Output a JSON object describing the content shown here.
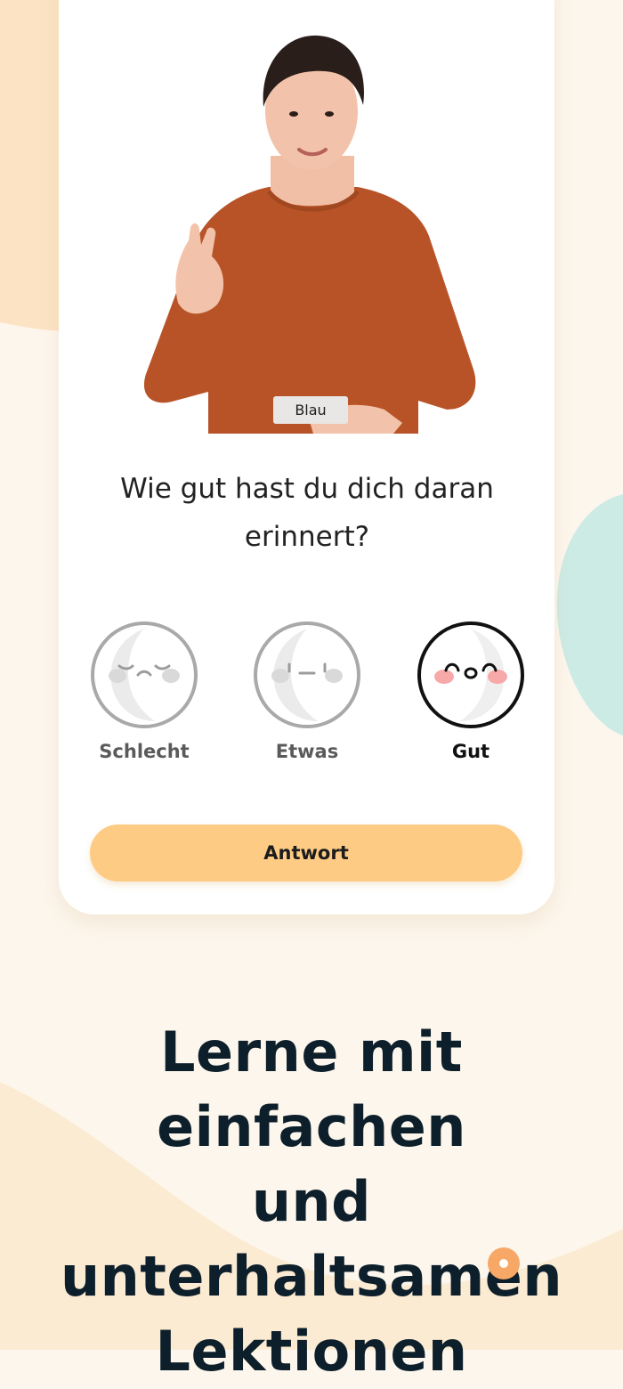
{
  "lesson": {
    "sign_caption": "Blau",
    "question": "Wie gut hast du dich daran erinnert?",
    "ratings": [
      {
        "label": "Schlecht",
        "selected": false
      },
      {
        "label": "Etwas",
        "selected": false
      },
      {
        "label": "Gut",
        "selected": true
      }
    ],
    "answer_button": "Antwort"
  },
  "promo": {
    "headline_line1": "Lerne mit einfachen",
    "headline_line2": "und unterhaltsamen",
    "headline_line3": "Lektionen"
  },
  "colors": {
    "accent": "#fdcb84",
    "shirt": "#b85327",
    "mint_deco": "#cdebe5",
    "orange_dot": "#f7a866",
    "headline": "#0d1f2b"
  }
}
